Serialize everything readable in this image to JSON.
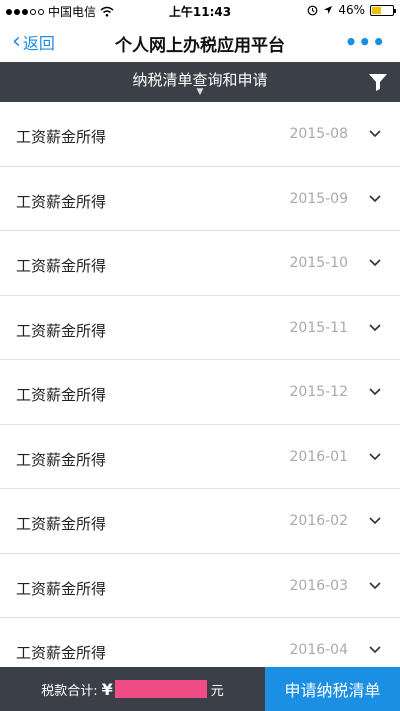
{
  "status_bar": {
    "carrier": "中国电信",
    "time": "上午11:43",
    "battery": "46%",
    "battery_level": 0.46
  },
  "nav": {
    "back_label": "返回",
    "title": "个人网上办税应用平台",
    "more_label": "•••"
  },
  "sub_header": {
    "title": "纳税清单查询和申请"
  },
  "items": [
    {
      "label": "工资薪金所得",
      "date": "2015-08"
    },
    {
      "label": "工资薪金所得",
      "date": "2015-09"
    },
    {
      "label": "工资薪金所得",
      "date": "2015-10"
    },
    {
      "label": "工资薪金所得",
      "date": "2015-11"
    },
    {
      "label": "工资薪金所得",
      "date": "2015-12"
    },
    {
      "label": "工资薪金所得",
      "date": "2016-01"
    },
    {
      "label": "工资薪金所得",
      "date": "2016-02"
    },
    {
      "label": "工资薪金所得",
      "date": "2016-03"
    },
    {
      "label": "工资薪金所得",
      "date": "2016-04"
    }
  ],
  "footer": {
    "total_label": "税款合计:",
    "currency_symbol": "¥",
    "unit": "元",
    "apply_label": "申请纳税清单"
  },
  "colors": {
    "accent": "#1a8fe3",
    "header_dark": "#3b3f47",
    "redaction": "#f04d86"
  }
}
